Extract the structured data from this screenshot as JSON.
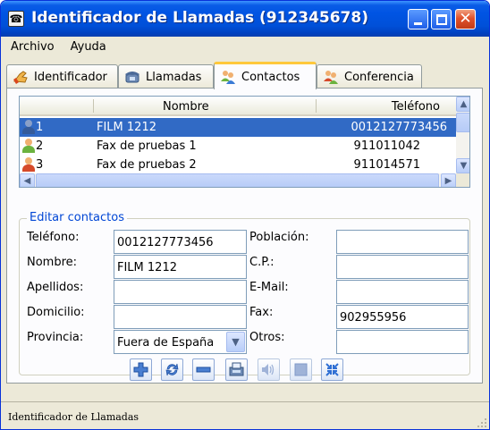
{
  "window": {
    "title": "Identificador de Llamadas (912345678)",
    "title_color": "#0054e3"
  },
  "menu": [
    "Archivo",
    "Ayuda"
  ],
  "tabs": [
    {
      "label": "Identificador",
      "icon": "hand-icon",
      "active": false
    },
    {
      "label": "Llamadas",
      "icon": "phone-icon",
      "active": false
    },
    {
      "label": "Contactos",
      "icon": "contacts-icon",
      "active": true
    },
    {
      "label": "Conferencia",
      "icon": "conference-icon",
      "active": false
    }
  ],
  "contacts_list": {
    "columns": [
      "Nombre",
      "Teléfono"
    ],
    "rows": [
      {
        "num": "1",
        "name": "FILM 1212",
        "tel": "0012127773456",
        "selected": true
      },
      {
        "num": "2",
        "name": "Fax de pruebas 1",
        "tel": "911011042",
        "selected": false
      },
      {
        "num": "3",
        "name": "Fax de pruebas 2",
        "tel": "911014571",
        "selected": false
      }
    ],
    "selected_color": "#316ac5"
  },
  "edit": {
    "title": "Editar contactos",
    "labels": {
      "telefono": "Teléfono:",
      "nombre": "Nombre:",
      "apellidos": "Apellidos:",
      "domicilio": "Domicilio:",
      "provincia": "Provincia:",
      "poblacion": "Población:",
      "cp": "C.P.:",
      "email": "E-Mail:",
      "fax": "Fax:",
      "otros": "Otros:"
    },
    "values": {
      "telefono": "0012127773456",
      "nombre": "FILM 1212",
      "apellidos": "",
      "domicilio": "",
      "provincia": "Fuera de España",
      "poblacion": "",
      "cp": "",
      "email": "",
      "fax": "902955956",
      "otros": ""
    }
  },
  "actions": [
    "add-icon",
    "refresh-icon",
    "remove-icon",
    "fax-icon",
    "speaker-icon",
    "stop-icon",
    "collapse-icon"
  ],
  "status": "Identificador de Llamadas"
}
